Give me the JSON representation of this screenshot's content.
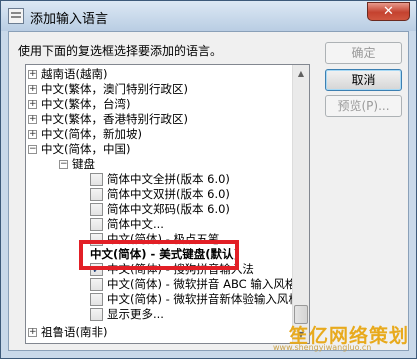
{
  "window": {
    "title": "添加输入语言",
    "close_glyph": "✕"
  },
  "instruction": "使用下面的复选框选择要添加的语言。",
  "buttons": {
    "ok": "确定",
    "cancel": "取消",
    "preview": "预览(P)..."
  },
  "tree": [
    {
      "label": "越南语(越南)",
      "expander": "+"
    },
    {
      "label": "中文(繁体，澳门特别行政区)",
      "expander": "+"
    },
    {
      "label": "中文(繁体，台湾)",
      "expander": "+"
    },
    {
      "label": "中文(繁体，香港特别行政区)",
      "expander": "+"
    },
    {
      "label": "中文(简体，新加坡)",
      "expander": "+"
    },
    {
      "label": "中文(简体，中国)",
      "expander": "−"
    },
    {
      "label": "键盘",
      "expander": "−"
    },
    {
      "label": "简体中文全拼(版本 6.0)",
      "checked": false
    },
    {
      "label": "简体中文双拼(版本 6.0)",
      "checked": false
    },
    {
      "label": "简体中文郑码(版本 6.0)",
      "checked": false
    },
    {
      "label": "简体中文...",
      "checked": false
    },
    {
      "label": "中文(简体) - 极点五笔",
      "checked": false
    },
    {
      "label": "中文(简体) - 美式键盘(默认)",
      "checked": false
    },
    {
      "label": "中文(简体) - 搜狗拼音输入法",
      "checked": true
    },
    {
      "label": "中文(简体) - 微软拼音 ABC 输入风格",
      "checked": false
    },
    {
      "label": "中文(简体) - 微软拼音新体验输入风格",
      "checked": false
    },
    {
      "label": "显示更多...",
      "checked": false
    },
    {
      "label": "祖鲁语(南非)",
      "expander": "+"
    }
  ],
  "scroll": {
    "up": "▲",
    "down": "▼"
  },
  "watermark": {
    "text": "笙亿网络策划",
    "sub": "www.shengyiwangluo.cn"
  },
  "colors": {
    "highlight": "#e21f26",
    "title_bg": "#c9d9ea",
    "watermark": "#e8aa1d"
  }
}
